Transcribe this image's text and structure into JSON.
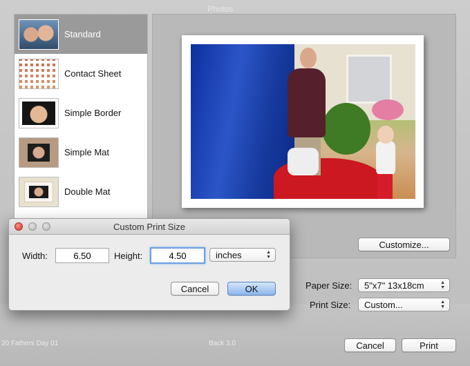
{
  "background": {
    "window_title": "Photos",
    "captions": [
      "20 Fathers Day 01",
      "Back 3.0"
    ]
  },
  "themes": [
    {
      "label": "Standard",
      "thumb": "two-smiling-faces",
      "selected": true
    },
    {
      "label": "Contact Sheet",
      "thumb": "grid-of-photos",
      "selected": false
    },
    {
      "label": "Simple Border",
      "thumb": "baby-portrait",
      "selected": false
    },
    {
      "label": "Simple Mat",
      "thumb": "girl-portrait-matted",
      "selected": false
    },
    {
      "label": "Double Mat",
      "thumb": "couple-double-matted",
      "selected": false
    }
  ],
  "preview": {
    "customize_label": "Customize..."
  },
  "print_settings": {
    "paper_size_label": "Paper Size:",
    "paper_size_value": "5\"x7\" 13x18cm",
    "print_size_label": "Print Size:",
    "print_size_value": "Custom..."
  },
  "footer": {
    "cancel_label": "Cancel",
    "print_label": "Print"
  },
  "dialog": {
    "title": "Custom Print Size",
    "width_label": "Width:",
    "width_value": "6.50",
    "height_label": "Height:",
    "height_value": "4.50",
    "unit_value": "inches",
    "cancel_label": "Cancel",
    "ok_label": "OK"
  },
  "colors": {
    "selection": "#9a9a9a",
    "default_button": "#8ab5ea",
    "focus_ring": "#6a9ee4"
  }
}
